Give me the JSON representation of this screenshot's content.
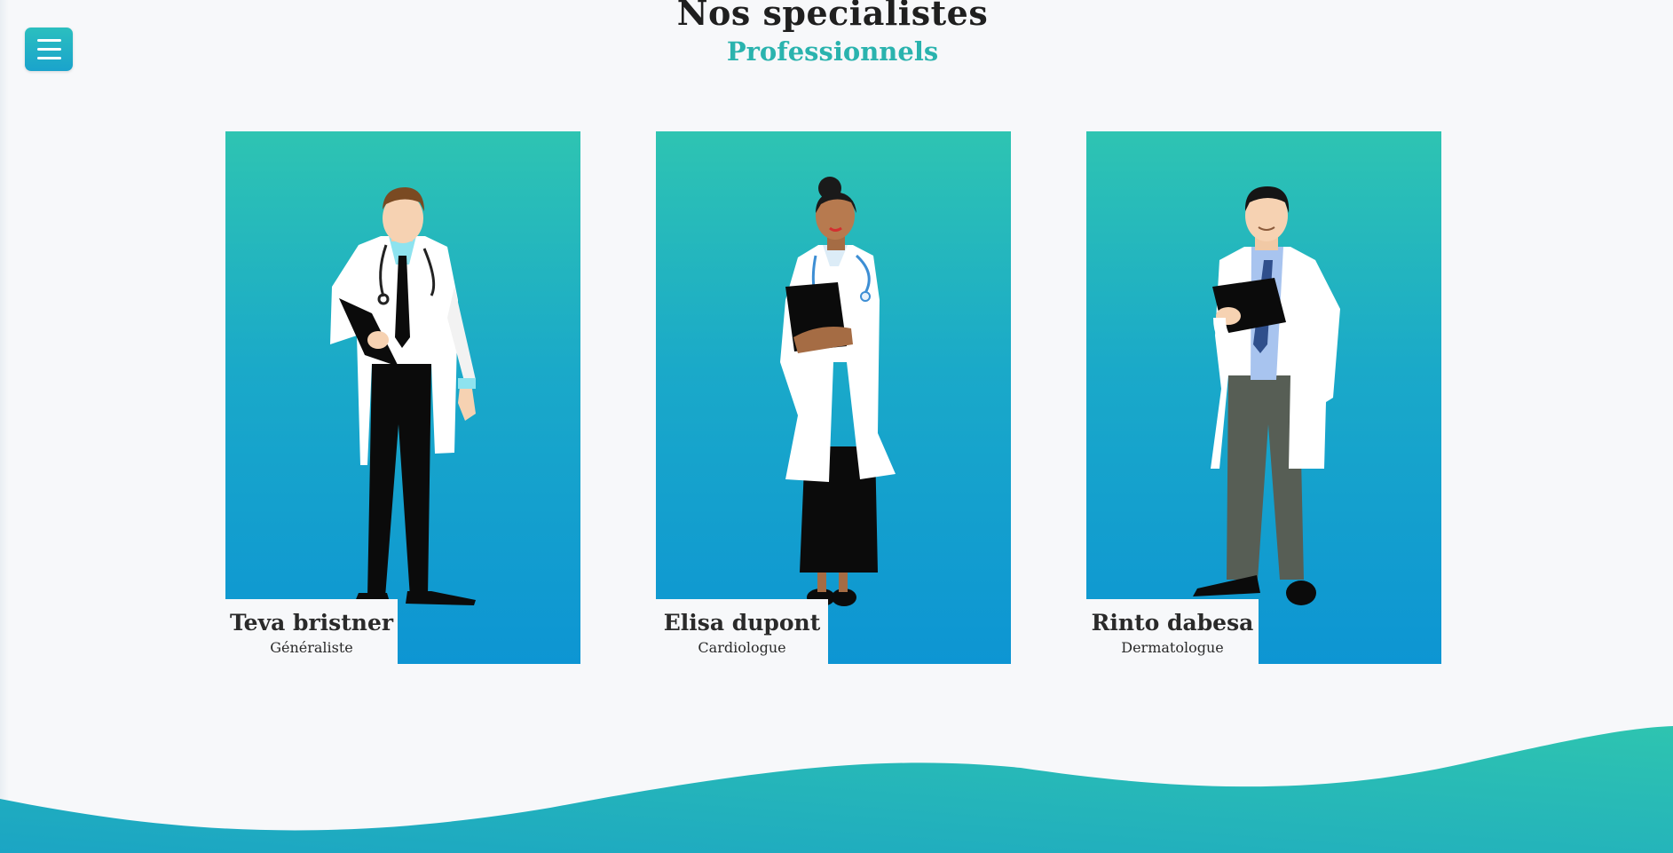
{
  "header": {
    "title": "Nos specialistes",
    "subtitle": "Professionnels"
  },
  "menu": {
    "icon": "hamburger-menu-icon"
  },
  "specialists": [
    {
      "name": "Teva bristner",
      "role": "Généraliste",
      "illustration": "doctor-man-clipboard-illustration"
    },
    {
      "name": "Elisa dupont",
      "role": "Cardiologue",
      "illustration": "doctor-woman-clipboard-illustration"
    },
    {
      "name": "Rinto dabesa",
      "role": "Dermatologue",
      "illustration": "doctor-man-blue-tie-illustration"
    }
  ],
  "colors": {
    "accent": "#2ab3ae",
    "card_gradient_top": "#2ec4b2",
    "card_gradient_bottom": "#0d95d3",
    "background": "#f7f8fa"
  }
}
